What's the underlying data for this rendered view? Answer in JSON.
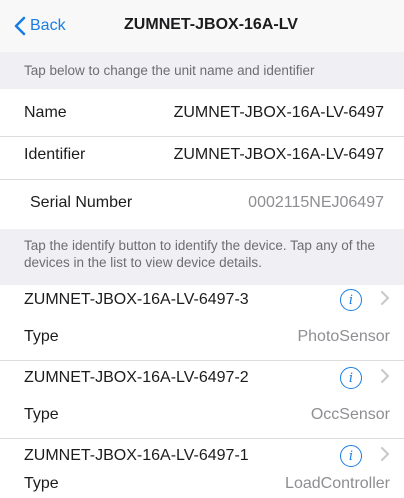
{
  "nav": {
    "back_label": "Back",
    "title": "ZUMNET-JBOX-16A-LV"
  },
  "unit_section": {
    "header": "Tap below to change the unit name and identifier",
    "name_label": "Name",
    "name_value": "ZUMNET-JBOX-16A-LV-6497",
    "identifier_label": "Identifier",
    "identifier_value": "ZUMNET-JBOX-16A-LV-6497",
    "serial_label": "Serial Number",
    "serial_value": "0002115NEJ06497"
  },
  "devices_section": {
    "header": "Tap the identify button to identify the device. Tap any of the devices in the list to view device details.",
    "type_label": "Type",
    "devices": [
      {
        "name": "ZUMNET-JBOX-16A-LV-6497-3",
        "type": "PhotoSensor"
      },
      {
        "name": "ZUMNET-JBOX-16A-LV-6497-2",
        "type": "OccSensor"
      },
      {
        "name": "ZUMNET-JBOX-16A-LV-6497-1",
        "type": "LoadController"
      }
    ]
  },
  "icons": {
    "back": "chevron-left-icon",
    "info": "info-icon",
    "chevron": "chevron-right-icon"
  },
  "colors": {
    "accent": "#1a7de3",
    "section_bg": "#efeff4",
    "secondary_text": "#8e8e93"
  }
}
